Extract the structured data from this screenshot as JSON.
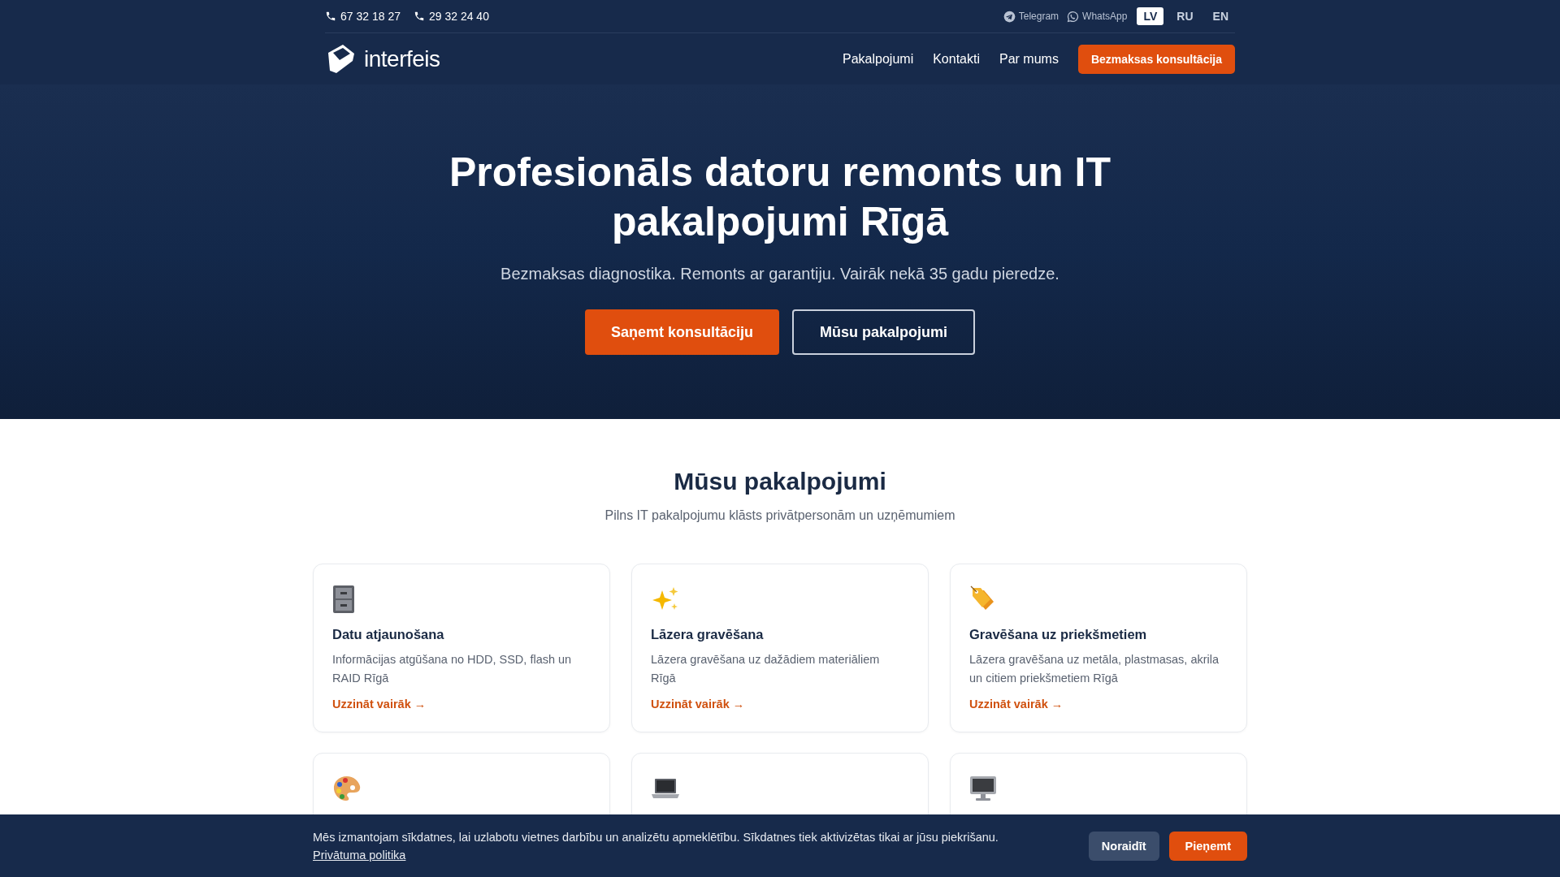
{
  "top_bar": {
    "phones": [
      "67 32 18 27",
      "29 32 24 40"
    ],
    "messengers": [
      "Telegram",
      "WhatsApp"
    ],
    "languages": [
      {
        "label": "LV",
        "selected": true
      },
      {
        "label": "RU",
        "selected": false
      },
      {
        "label": "EN",
        "selected": false
      }
    ]
  },
  "nav": {
    "logo": "interfeis",
    "links": [
      "Pakalpojumi",
      "Kontakti",
      "Par mums"
    ],
    "cta": "Bezmaksas konsultācija"
  },
  "hero": {
    "title": "Profesionāls datoru remonts un IT pakalpojumi Rīgā",
    "subtitle": "Bezmaksas diagnostika. Remonts ar garantiju. Vairāk nekā 35 gadu pieredze.",
    "primary_button": "Saņemt konsultāciju",
    "secondary_button": "Mūsu pakalpojumi"
  },
  "services": {
    "title": "Mūsu pakalpojumi",
    "subtitle": "Pilns IT pakalpojumu klāsts privātpersonām un uzņēmumiem",
    "cards": [
      {
        "kind": "text",
        "title": "Datu atjaunošana",
        "description": "Informācijas atgūšana no HDD, SSD, flash un RAID Rīgā",
        "link": "Uzzināt vairāk →"
      },
      {
        "kind": "text",
        "title": "Lāzera gravēšana",
        "description": "Lāzera gravēšana uz dažādiem materiāliem Rīgā",
        "link": "Uzzināt vairāk →"
      },
      {
        "kind": "text",
        "title": "Gravēšana uz priekšmetiem",
        "description": "Lāzera gravēšana uz metāla, plastmasas, akrila un citiem priekšmetiem Rīgā",
        "link": "Uzzināt vairāk →"
      },
      {
        "kind": "icon"
      },
      {
        "kind": "icon"
      },
      {
        "kind": "icon"
      }
    ]
  },
  "cookie_banner": {
    "text": "Mēs izmantojam sīkdatnes, lai uzlabotu vietnes darbību un analizētu apmeklētību. Sīkdatnes tiek aktivizētas tikai ar jūsu piekrišanu.",
    "policy_link": "Privātuma politika",
    "decline_button": "Noraidīt",
    "accept_button": "Pieņemt"
  }
}
